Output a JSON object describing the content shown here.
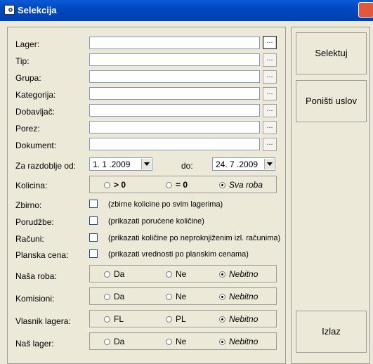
{
  "window": {
    "title": "Selekcija"
  },
  "fields": [
    {
      "label": "Lager:",
      "value": ""
    },
    {
      "label": "Tip:",
      "value": ""
    },
    {
      "label": "Grupa:",
      "value": ""
    },
    {
      "label": "Kategorija:",
      "value": ""
    },
    {
      "label": "Dobavljač:",
      "value": ""
    },
    {
      "label": "Porez:",
      "value": ""
    },
    {
      "label": "Dokument:",
      "value": ""
    }
  ],
  "browse_label": "...",
  "period": {
    "label": "Za razdoblje od:",
    "from": "1. 1 .2009",
    "to_label": "do:",
    "to": "24. 7 .2009"
  },
  "kolicina": {
    "label": "Kolicina:",
    "options": [
      "> 0",
      "= 0",
      "Sva roba"
    ],
    "selected": "Sva roba"
  },
  "checks": [
    {
      "label": "Zbirno:",
      "note": "(zbirne kolicine po svim lagerima)",
      "checked": false
    },
    {
      "label": "Porudžbe:",
      "note": "(prikazati porućene količine)",
      "checked": false
    },
    {
      "label": "Računi:",
      "note": "(prikazati količine po neproknjiženim izl. računima)",
      "checked": false
    },
    {
      "label": "Planska cena:",
      "note": "(prikazati vrednosti po planskim cenama)",
      "checked": false
    }
  ],
  "radio_groups": [
    {
      "label": "Naša roba:",
      "options": [
        "Da",
        "Ne",
        "Nebitno"
      ],
      "selected": "Nebitno"
    },
    {
      "label": "Komisioni:",
      "options": [
        "Da",
        "Ne",
        "Nebitno"
      ],
      "selected": "Nebitno"
    },
    {
      "label": "Vlasnik lagera:",
      "options": [
        "FL",
        "PL",
        "Nebitno"
      ],
      "selected": "Nebitno"
    },
    {
      "label": "Naš lager:",
      "options": [
        "Da",
        "Ne",
        "Nebitno"
      ],
      "selected": "Nebitno"
    }
  ],
  "buttons": {
    "select": "Selektuj",
    "reset": "Poništi uslov",
    "exit": "Izlaz"
  }
}
